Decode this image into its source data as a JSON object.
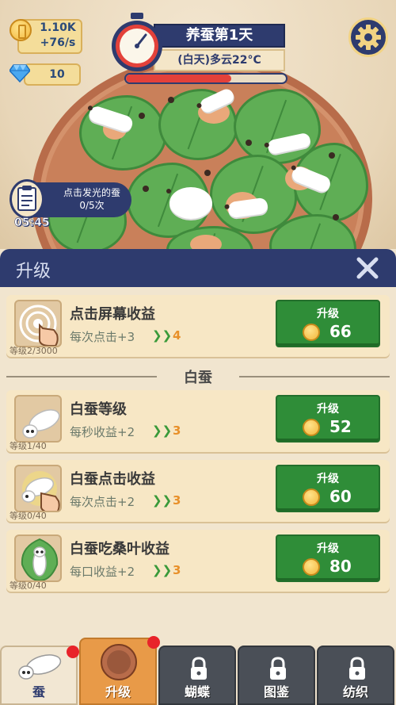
{
  "hud": {
    "coins": "1.10K",
    "coin_rate": "+76/s",
    "gems": "10"
  },
  "header": {
    "title": "养蚕第1天",
    "weather": "(白天)多云22°C",
    "day_progress": 0.66
  },
  "task": {
    "text": "点击发光的蚕",
    "count": "0/5次",
    "timer": "05:45"
  },
  "panel": {
    "title": "升级",
    "section_label": "白蚕",
    "cards": [
      {
        "title": "点击屏幕收益",
        "desc": "每次点击+3",
        "next": "4",
        "level": "等级2/3000",
        "button": "升级",
        "price": "66",
        "icon": "tap-hand-icon"
      },
      {
        "title": "白蚕等级",
        "desc": "每秒收益+2",
        "next": "3",
        "level": "等级1/40",
        "button": "升级",
        "price": "52",
        "icon": "silkworm-icon"
      },
      {
        "title": "白蚕点击收益",
        "desc": "每次点击+2",
        "next": "3",
        "level": "等级0/40",
        "button": "升级",
        "price": "60",
        "icon": "silkworm-tap-icon"
      },
      {
        "title": "白蚕吃桑叶收益",
        "desc": "每口收益+2",
        "next": "3",
        "level": "等级0/40",
        "button": "升级",
        "price": "80",
        "icon": "silkworm-leaf-icon"
      }
    ]
  },
  "tabs": [
    {
      "label": "蚕",
      "icon": "silkworm-icon",
      "locked": false
    },
    {
      "label": "升级",
      "icon": "tray-icon",
      "locked": false
    },
    {
      "label": "蝴蝶",
      "icon": "lock-icon",
      "locked": true
    },
    {
      "label": "图鉴",
      "icon": "lock-icon",
      "locked": true
    },
    {
      "label": "纺织",
      "icon": "lock-icon",
      "locked": true
    }
  ],
  "colors": {
    "navy": "#2e3b6e",
    "buy_green": "#2f8d38",
    "leaf_green": "#5fae55",
    "accent_orange": "#e8902a",
    "notify_red": "#e8232a"
  }
}
